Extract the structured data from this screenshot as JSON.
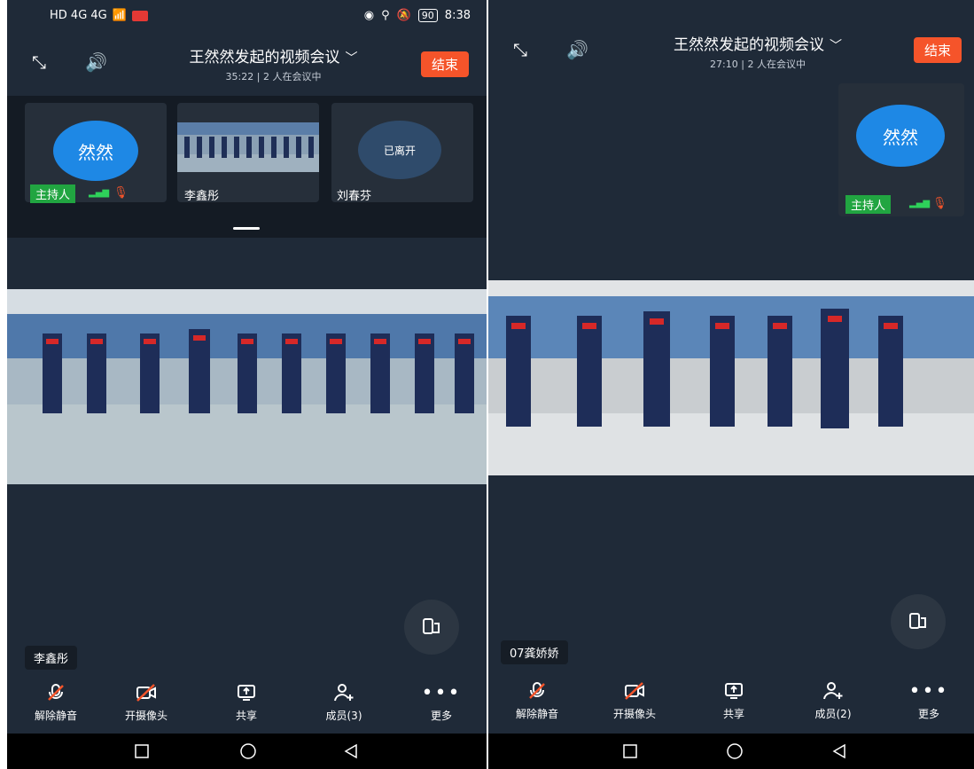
{
  "left": {
    "status": {
      "network": "HD 4G 4G",
      "battery": "90",
      "time": "8:38"
    },
    "header": {
      "title": "王然然发起的视频会议",
      "subtitle": "35:22 | 2 人在会议中",
      "end_label": "结束"
    },
    "thumbs": [
      {
        "avatar_text": "然然",
        "host_label": "主持人"
      },
      {
        "name": "李鑫彤"
      },
      {
        "avatar_text": "已离开",
        "name": "刘春芬"
      }
    ],
    "speaker_name": "李鑫彤",
    "toolbar": [
      {
        "label": "解除静音",
        "icon": "mic-off-icon"
      },
      {
        "label": "开摄像头",
        "icon": "camera-off-icon"
      },
      {
        "label": "共享",
        "icon": "share-screen-icon"
      },
      {
        "label": "成员(3)",
        "icon": "add-member-icon"
      },
      {
        "label": "更多",
        "icon": "more-icon"
      }
    ]
  },
  "right": {
    "header": {
      "title": "王然然发起的视频会议",
      "subtitle": "27:10 | 2 人在会议中",
      "end_label": "结束"
    },
    "thumbs": [
      {
        "avatar_text": "然然",
        "host_label": "主持人"
      }
    ],
    "speaker_name": "07龚娇娇",
    "toolbar": [
      {
        "label": "解除静音",
        "icon": "mic-off-icon"
      },
      {
        "label": "开摄像头",
        "icon": "camera-off-icon"
      },
      {
        "label": "共享",
        "icon": "share-screen-icon"
      },
      {
        "label": "成员(2)",
        "icon": "add-member-icon"
      },
      {
        "label": "更多",
        "icon": "more-icon"
      }
    ]
  },
  "colors": {
    "end": "#f5542a",
    "host": "#21a541",
    "avatar": "#1e88e5",
    "bg": "#1f2a38"
  }
}
